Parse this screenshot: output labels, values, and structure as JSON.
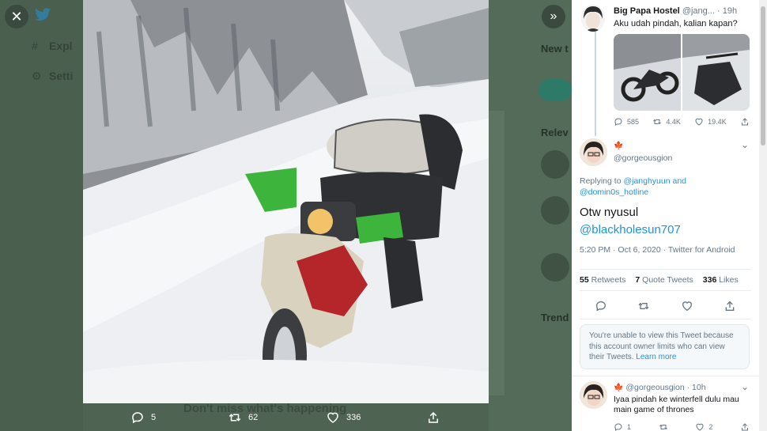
{
  "viewer": {
    "close_icon": "close-icon",
    "expand_icon": "chevrons-right-icon",
    "logo_icon": "twitter-bird-icon"
  },
  "background": {
    "nav_explore": "Expl",
    "nav_settings": "Setti",
    "right_new": "New t",
    "right_relevant": "Relev",
    "right_trends": "Trend",
    "bottom_headline": "Don't miss what's happening"
  },
  "media_actions": {
    "replies": "5",
    "retweets": "62",
    "likes": "336"
  },
  "parent_tweet": {
    "name": "Big Papa Hostel",
    "handle": "@jang...",
    "time": "19h",
    "text": "Aku udah pindah, kalian kapan?",
    "replies": "585",
    "retweets": "4.4K",
    "likes": "19.4K"
  },
  "main_tweet": {
    "handle": "@gorgeousgion",
    "replying_prefix": "Replying to",
    "reply_to_1": "@janghyuun",
    "reply_and": "and",
    "reply_to_2": "@domin0s_hotline",
    "text_line1": "Otw nyusul",
    "mention": "@blackholesun707",
    "meta": "5:20 PM · Oct 6, 2020 · Twitter for Android",
    "retweets_count": "55",
    "retweets_label": "Retweets",
    "quotes_count": "7",
    "quotes_label": "Quote Tweets",
    "likes_count": "336",
    "likes_label": "Likes"
  },
  "notice": {
    "text": "You're unable to view this Tweet because this account owner limits who can view their Tweets.",
    "link": "Learn more"
  },
  "reply_tweet": {
    "handle": "@gorgeousgion",
    "time": "10h",
    "text": "Iyaa pindah ke winterfell dulu mau main game of thrones",
    "replies": "1",
    "likes": "2"
  },
  "colors": {
    "accent": "#1b95e0",
    "overlay": "#4e6352",
    "flag": "#d52b1e"
  }
}
